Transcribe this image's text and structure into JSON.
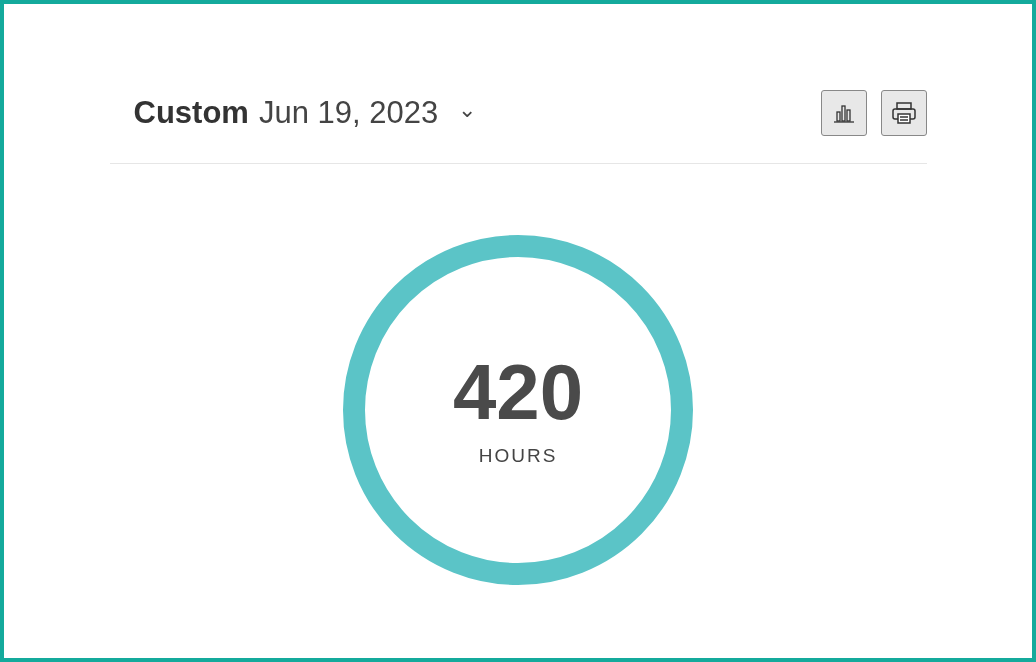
{
  "header": {
    "range_label": "Custom",
    "date": "Jun 19, 2023",
    "dropdown_glyph": "⌄"
  },
  "toolbar": {
    "buttons": [
      {
        "kind": "chart"
      },
      {
        "kind": "print"
      }
    ]
  },
  "total": {
    "value": "420",
    "unit": "HOURS"
  }
}
